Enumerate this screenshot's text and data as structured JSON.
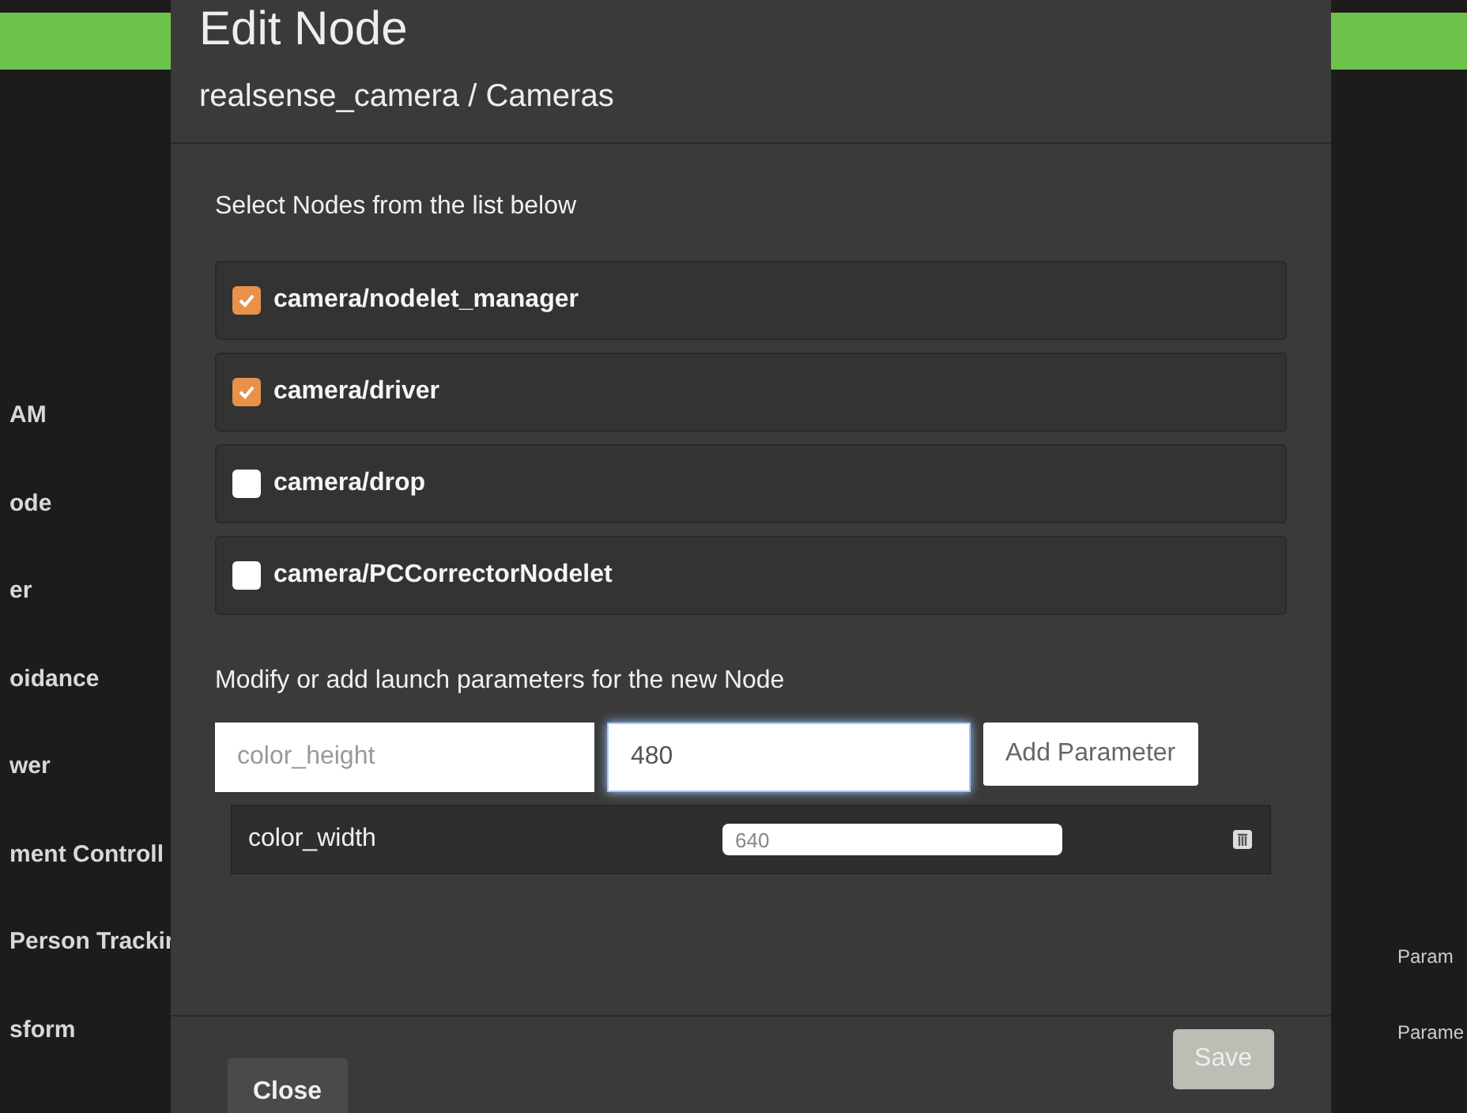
{
  "sidebar": {
    "items": [
      "AM",
      "ode",
      "er",
      "oidance",
      "wer",
      "ment Controll",
      "Person Trackir",
      "sform"
    ]
  },
  "right_panel": {
    "labels": [
      "Param",
      "Parame"
    ]
  },
  "dialog": {
    "title": "Edit Node",
    "subtitle": "realsense_camera / Cameras",
    "nodes_label": "Select Nodes from the list below",
    "nodes": [
      {
        "label": "camera/nodelet_manager",
        "checked": true
      },
      {
        "label": "camera/driver",
        "checked": true
      },
      {
        "label": "camera/drop",
        "checked": false
      },
      {
        "label": "camera/PCCorrectorNodelet",
        "checked": false
      }
    ],
    "params_label": "Modify or add launch parameters for the new Node",
    "new_param": {
      "name_placeholder": "color_height",
      "value": "480",
      "add_button": "Add Parameter"
    },
    "params": [
      {
        "name": "color_width",
        "value": "640"
      }
    ],
    "close_button": "Close",
    "save_button": {
      "label": "Save",
      "disabled": true
    }
  }
}
